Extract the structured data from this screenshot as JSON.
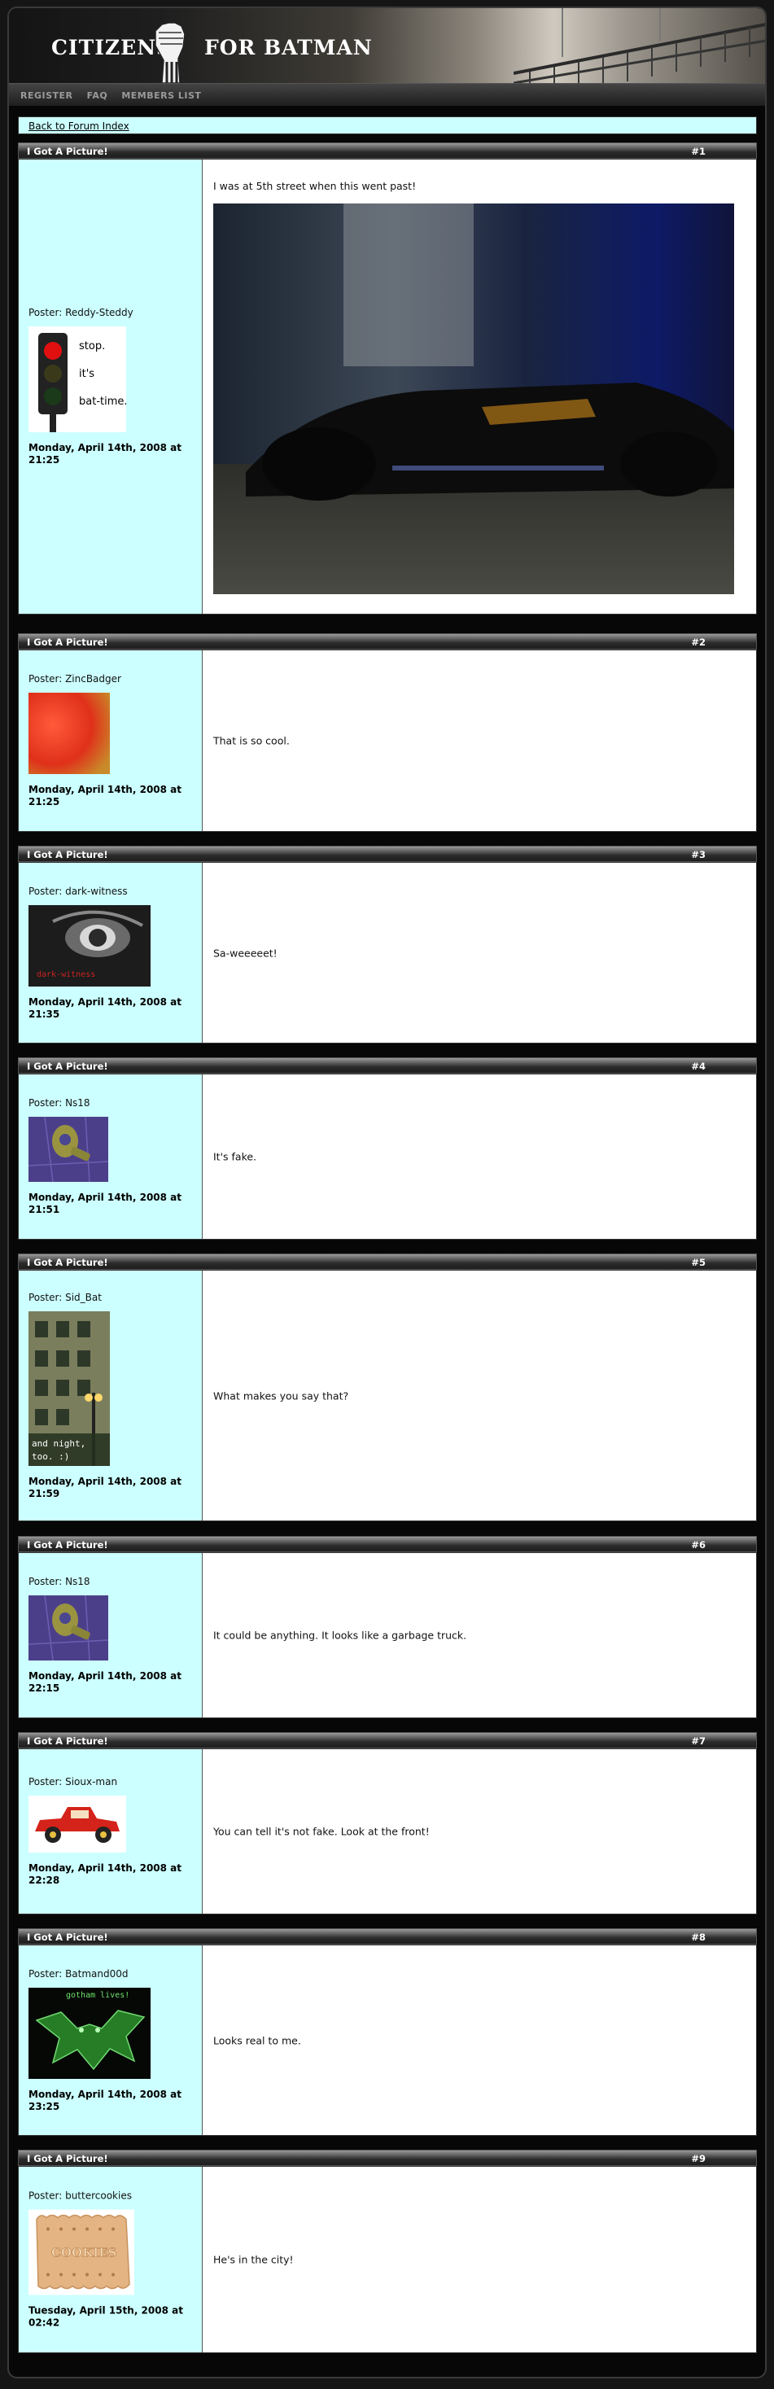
{
  "site": {
    "logo_left": "CITIZENS",
    "logo_right": "FOR BATMAN"
  },
  "nav": {
    "items": [
      "REGISTER",
      "FAQ",
      "MEMBERS LIST"
    ]
  },
  "back_link": "Back to Forum Index",
  "thread_title": "I Got A Picture!",
  "avatar_texts": {
    "reddy_lines": [
      "stop.",
      "it's",
      "bat-time."
    ],
    "darkwitness_caption": "dark-witness",
    "sidbat_lines": [
      "and night,",
      "too. :)"
    ],
    "batmand_caption": "gotham lives!",
    "cookies_caption": "COOKIES"
  },
  "posts": [
    {
      "num": "#1",
      "poster": "Poster: Reddy-Steddy",
      "date": "Monday, April 14th, 2008 at 21:25",
      "message": "I was at 5th street when this went past!"
    },
    {
      "num": "#2",
      "poster": "Poster: ZincBadger",
      "date": "Monday, April 14th, 2008 at 21:25",
      "message": "That is so cool."
    },
    {
      "num": "#3",
      "poster": "Poster: dark-witness",
      "date": "Monday, April 14th, 2008 at 21:35",
      "message": "Sa-weeeeet!"
    },
    {
      "num": "#4",
      "poster": "Poster: Ns18",
      "date": "Monday, April 14th, 2008 at 21:51",
      "message": "It's fake."
    },
    {
      "num": "#5",
      "poster": "Poster: Sid_Bat",
      "date": "Monday, April 14th, 2008 at 21:59",
      "message": "What makes you say that?"
    },
    {
      "num": "#6",
      "poster": "Poster: Ns18",
      "date": "Monday, April 14th, 2008 at 22:15",
      "message": "It could be anything. It looks like a garbage truck."
    },
    {
      "num": "#7",
      "poster": "Poster: Sioux-man",
      "date": "Monday, April 14th, 2008 at 22:28",
      "message": "You can tell it's not fake. Look at the front!"
    },
    {
      "num": "#8",
      "poster": "Poster: Batmand00d",
      "date": "Monday, April 14th, 2008 at 23:25",
      "message": "Looks real to me."
    },
    {
      "num": "#9",
      "poster": "Poster: buttercookies",
      "date": "Tuesday, April 15th, 2008 at 02:42",
      "message": "He's in the city!"
    }
  ]
}
